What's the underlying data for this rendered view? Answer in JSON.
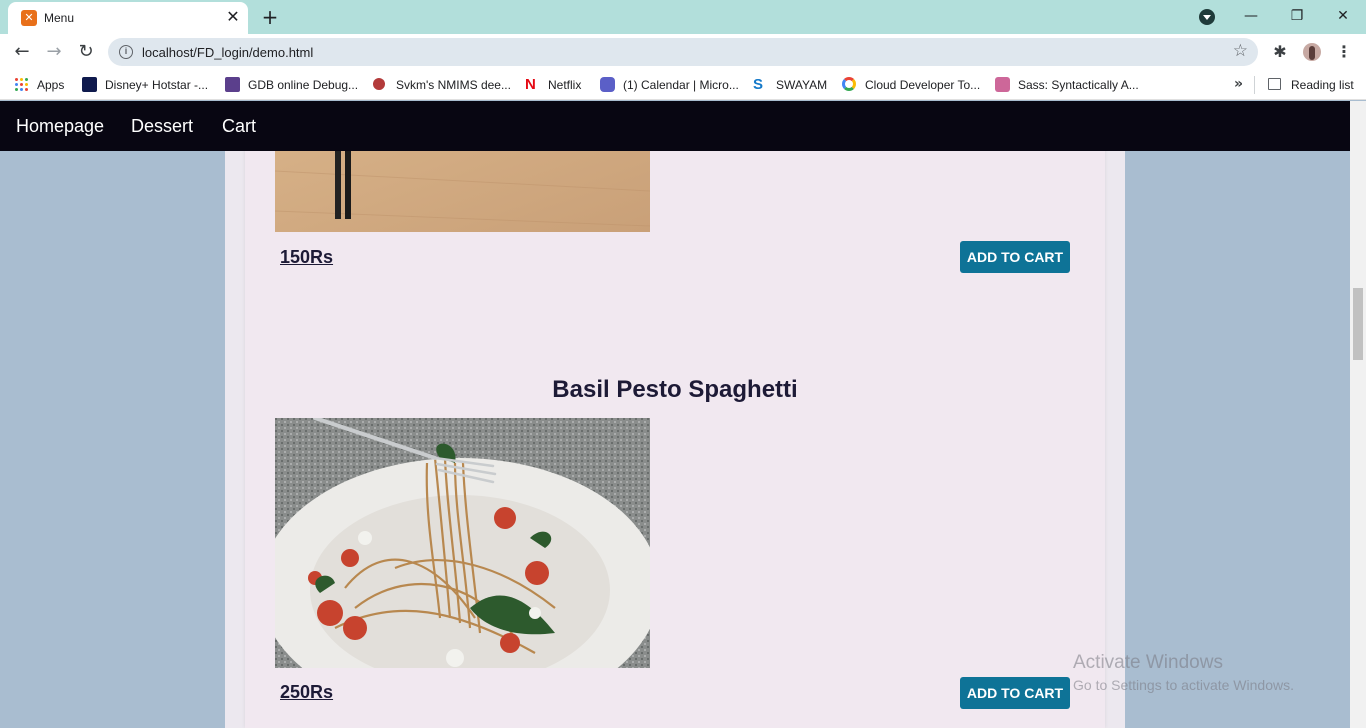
{
  "browser": {
    "tab_title": "Menu",
    "tab_favicon": "xampp-icon",
    "url": "localhost/FD_login/demo.html",
    "bookmarks": [
      {
        "label": "Apps",
        "icon": "apps-grid-icon"
      },
      {
        "label": "Disney+ Hotstar -...",
        "icon": "hotstar-icon"
      },
      {
        "label": "GDB online Debug...",
        "icon": "gdb-icon"
      },
      {
        "label": "Svkm's NMIMS dee...",
        "icon": "nmims-icon"
      },
      {
        "label": "Netflix",
        "icon": "netflix-icon"
      },
      {
        "label": "(1) Calendar | Micro...",
        "icon": "teams-icon"
      },
      {
        "label": "SWAYAM",
        "icon": "swayam-icon"
      },
      {
        "label": "Cloud Developer To...",
        "icon": "google-cloud-icon"
      },
      {
        "label": "Sass: Syntactically A...",
        "icon": "sass-icon"
      }
    ],
    "reading_list": "Reading list"
  },
  "site_nav": {
    "items": [
      "Homepage",
      "Dessert",
      "Cart"
    ]
  },
  "menu_items": [
    {
      "name": "",
      "price": "150Rs",
      "button": "ADD TO CART",
      "image": "noodle-soup-bowl"
    },
    {
      "name": "Basil Pesto Spaghetti",
      "price": "250Rs",
      "button": "ADD TO CART",
      "image": "spaghetti-on-fork"
    }
  ],
  "watermark": {
    "line1": "Activate Windows",
    "line2": "Go to Settings to activate Windows."
  },
  "colors": {
    "tabstrip": "#b2dfdb",
    "site_nav": "#080612",
    "page_bg": "#a9bdd0",
    "card_bg": "#f1e8f0",
    "button": "#0e7397",
    "title_text": "#1d1a36"
  }
}
